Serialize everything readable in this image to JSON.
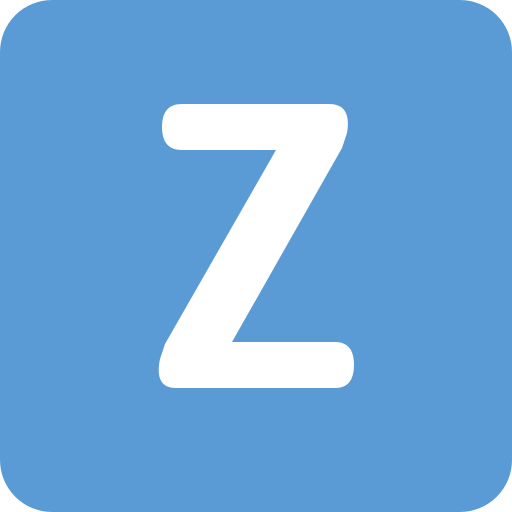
{
  "tile": {
    "letter": "Z",
    "background_color": "#5b9bd5",
    "letter_color": "#ffffff"
  }
}
